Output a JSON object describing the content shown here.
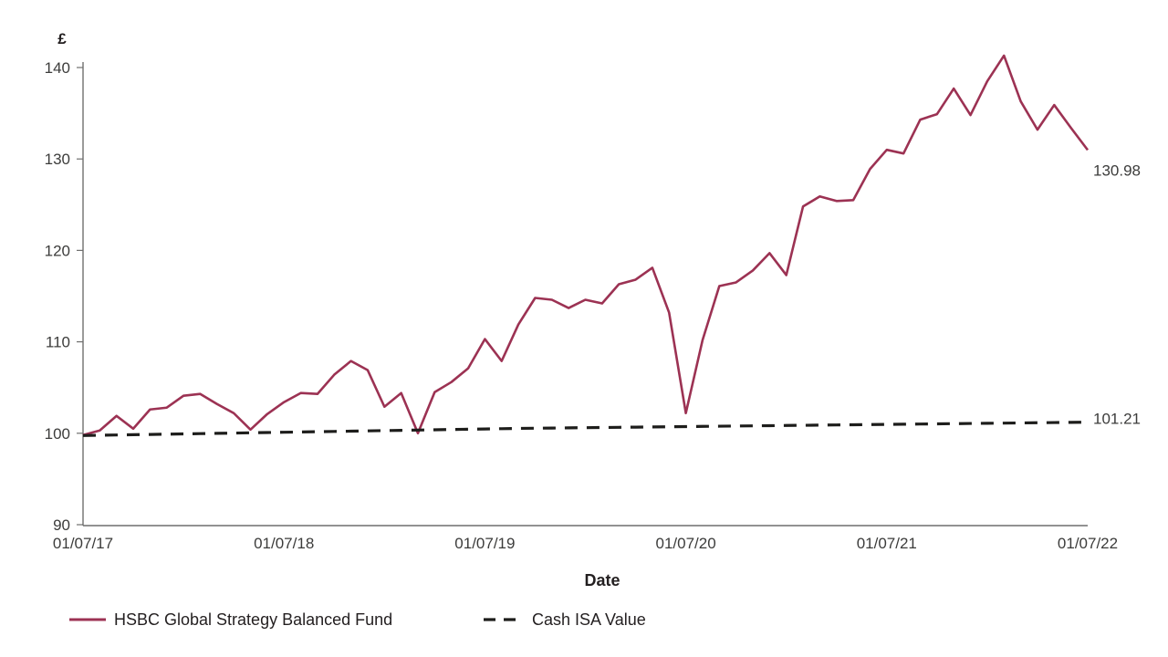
{
  "chart_data": {
    "type": "line",
    "title": "",
    "xlabel": "Date",
    "ylabel": "£",
    "ylim": [
      90,
      140
    ],
    "y_ticks": [
      90,
      100,
      110,
      120,
      130,
      140
    ],
    "x_tick_labels": [
      "01/07/17",
      "01/07/18",
      "01/07/19",
      "01/07/20",
      "01/07/21",
      "01/07/22"
    ],
    "grid": false,
    "legend_position": "bottom-left",
    "x_axis_kind": "monthly-dates",
    "n_points": 61,
    "series": [
      {
        "name": "HSBC Global Strategy Balanced Fund",
        "color": "#9c3253",
        "style": "solid",
        "end_label": "130.98",
        "values": [
          99.8,
          100.3,
          101.9,
          100.5,
          102.6,
          102.8,
          104.1,
          104.3,
          103.2,
          102.2,
          100.4,
          102.1,
          103.4,
          104.4,
          104.3,
          106.4,
          107.9,
          106.9,
          102.9,
          104.4,
          100.0,
          104.5,
          105.6,
          107.1,
          110.3,
          107.9,
          111.9,
          114.8,
          114.6,
          113.7,
          114.6,
          114.2,
          116.3,
          116.8,
          118.1,
          113.2,
          102.2,
          110.2,
          116.1,
          116.5,
          117.8,
          119.7,
          117.3,
          124.8,
          125.9,
          125.4,
          125.5,
          128.9,
          131.0,
          130.6,
          134.3,
          134.9,
          137.7,
          134.8,
          138.5,
          141.3,
          136.3,
          133.2,
          135.9,
          133.4,
          130.98
        ]
      },
      {
        "name": "Cash ISA Value",
        "color": "#1d1d1b",
        "style": "dashed",
        "end_label": "101.21",
        "values": [
          99.75,
          99.78,
          99.81,
          99.84,
          99.87,
          99.9,
          99.93,
          99.96,
          99.99,
          100.02,
          100.05,
          100.08,
          100.11,
          100.14,
          100.17,
          100.2,
          100.23,
          100.26,
          100.29,
          100.32,
          100.35,
          100.38,
          100.41,
          100.44,
          100.47,
          100.5,
          100.53,
          100.55,
          100.57,
          100.59,
          100.61,
          100.63,
          100.65,
          100.67,
          100.69,
          100.71,
          100.73,
          100.75,
          100.77,
          100.79,
          100.81,
          100.83,
          100.85,
          100.87,
          100.89,
          100.91,
          100.93,
          100.95,
          100.97,
          100.99,
          101.01,
          101.03,
          101.05,
          101.07,
          101.09,
          101.11,
          101.13,
          101.15,
          101.17,
          101.19,
          101.21
        ]
      }
    ]
  },
  "axis": {
    "unit_symbol": "£",
    "x_title": "Date"
  },
  "legend": {
    "items": [
      {
        "label": "HSBC Global Strategy Balanced Fund",
        "swatch": "solid-line-swatch"
      },
      {
        "label": "Cash ISA Value",
        "swatch": "dashed-line-swatch"
      }
    ]
  },
  "colors": {
    "fund_line": "#9c3253",
    "cash_line": "#1d1d1b",
    "axis": "#6f6f6e",
    "text": "#231f20",
    "background": "#ffffff"
  }
}
